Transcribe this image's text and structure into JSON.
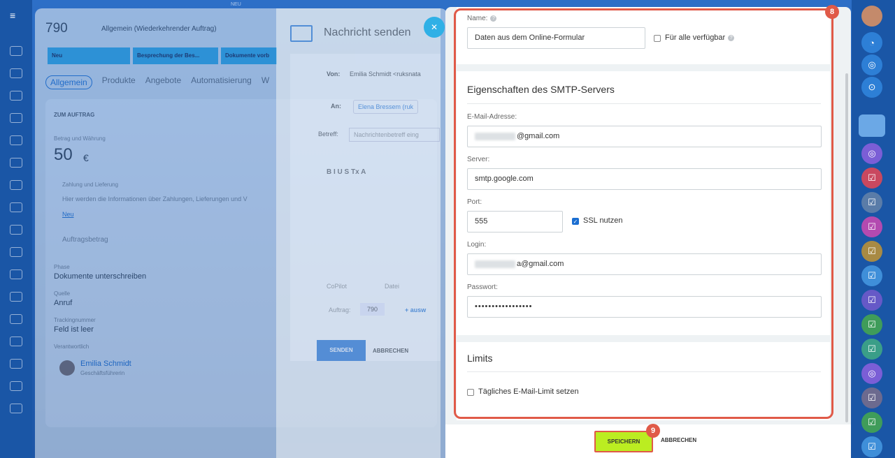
{
  "deal": {
    "title": "790",
    "subtitle": "Allgemein (Wiederkehrender Auftrag)",
    "stages": [
      "Neu",
      "Besprechung der Bes...",
      "Dokumente vorb"
    ],
    "tabs": [
      "Allgemein",
      "Produkte",
      "Angebote",
      "Automatisierung",
      "W"
    ],
    "section": "ZUM AUFTRAG",
    "amount_label": "Betrag und Währung",
    "amount": "50",
    "currency": "€",
    "payment_label": "Zahlung und Lieferung",
    "payment_text": "Hier werden die Informationen über Zahlungen, Lieferungen und V",
    "payment_link": "Neu",
    "order_amount": "Auftragsbetrag",
    "phase_label": "Phase",
    "phase": "Dokumente unterschreiben",
    "source_label": "Quelle",
    "source": "Anruf",
    "tracking_label": "Trackingnummer",
    "tracking": "Feld ist leer",
    "resp_label": "Verantwortlich",
    "person": "Emilia Schmidt",
    "person_role": "Geschäftsführerin"
  },
  "message": {
    "title": "Nachricht senden",
    "from_label": "Von:",
    "from": "Emilia Schmidt <ruksnata",
    "to_label": "An:",
    "to": "Elena Bressem (ruk",
    "subject_label": "Betreff:",
    "subject_placeholder": "Nachrichtenbetreff eing",
    "toolbar": "B  I  U  S  Tx  A",
    "copilot": "CoPilot",
    "file": "Datei",
    "order_label": "Auftrag:",
    "order": "790",
    "add": "+ ausw",
    "send": "SENDEN",
    "cancel": "ABBRECHEN",
    "close": "✕"
  },
  "form": {
    "name_label": "Name:",
    "name_value": "Daten aus dem Online-Formular",
    "for_all": "Für alle verfügbar",
    "smtp_title": "Eigenschaften des SMTP-Servers",
    "email_label": "E-Mail-Adresse:",
    "email_value": "@gmail.com",
    "server_label": "Server:",
    "server_value": "smtp.google.com",
    "port_label": "Port:",
    "port_value": "555",
    "ssl_label": "SSL nutzen",
    "login_label": "Login:",
    "login_value": "a@gmail.com",
    "password_label": "Passwort:",
    "password_value": "•••••••••••••••••",
    "limits_title": "Limits",
    "daily_limit": "Tägliches E-Mail-Limit setzen",
    "save": "SPEICHERN",
    "cancel": "ABBRECHEN"
  },
  "badges": {
    "first": "8",
    "second": "9"
  },
  "top_label": "NEU"
}
